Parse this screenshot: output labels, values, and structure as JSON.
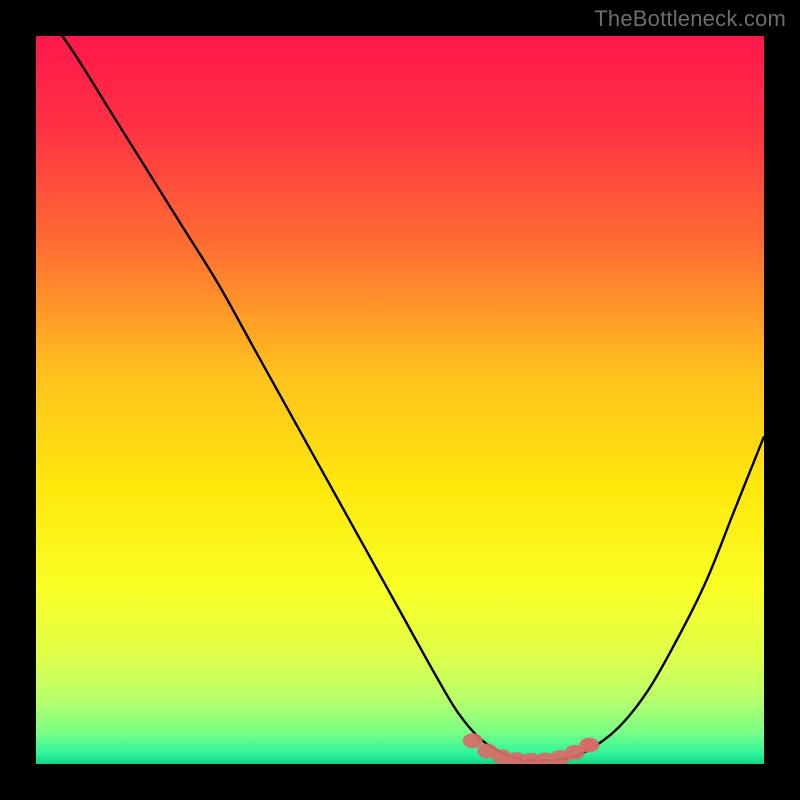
{
  "watermark": "TheBottleneck.com",
  "colors": {
    "black": "#000000",
    "curve": "#000000",
    "marker_fill": "#d96a68",
    "gradient_stops": [
      {
        "offset": 0.0,
        "color": "#ff184b"
      },
      {
        "offset": 0.12,
        "color": "#ff3044"
      },
      {
        "offset": 0.28,
        "color": "#ff6a33"
      },
      {
        "offset": 0.46,
        "color": "#ffc01e"
      },
      {
        "offset": 0.62,
        "color": "#ffe80c"
      },
      {
        "offset": 0.76,
        "color": "#f8ff24"
      },
      {
        "offset": 0.85,
        "color": "#e0ff4a"
      },
      {
        "offset": 0.91,
        "color": "#b8ff6a"
      },
      {
        "offset": 0.955,
        "color": "#7cff86"
      },
      {
        "offset": 0.985,
        "color": "#30f59a"
      },
      {
        "offset": 1.0,
        "color": "#12d686"
      }
    ]
  },
  "chart_data": {
    "type": "line",
    "title": "",
    "xlabel": "",
    "ylabel": "",
    "xlim": [
      0,
      100
    ],
    "ylim": [
      0,
      100
    ],
    "series": [
      {
        "name": "bottleneck-curve",
        "x": [
          0,
          5,
          10,
          15,
          20,
          25,
          30,
          35,
          40,
          45,
          50,
          55,
          58,
          61,
          64,
          67,
          70,
          73,
          76,
          80,
          84,
          88,
          92,
          96,
          100
        ],
        "y": [
          105,
          98,
          90,
          82,
          74,
          66,
          57,
          48,
          39,
          30,
          21,
          12,
          7,
          3.5,
          1.5,
          0.6,
          0.5,
          0.8,
          2,
          5,
          10,
          17,
          25,
          35,
          45
        ]
      }
    ],
    "markers": {
      "name": "optimal-band",
      "x": [
        60,
        62,
        64,
        66,
        68,
        70,
        72,
        74,
        76
      ],
      "y": [
        3.2,
        1.8,
        1.0,
        0.6,
        0.5,
        0.55,
        0.9,
        1.6,
        2.6
      ]
    },
    "marker_dot": {
      "x": 76,
      "y": 2.6
    }
  }
}
